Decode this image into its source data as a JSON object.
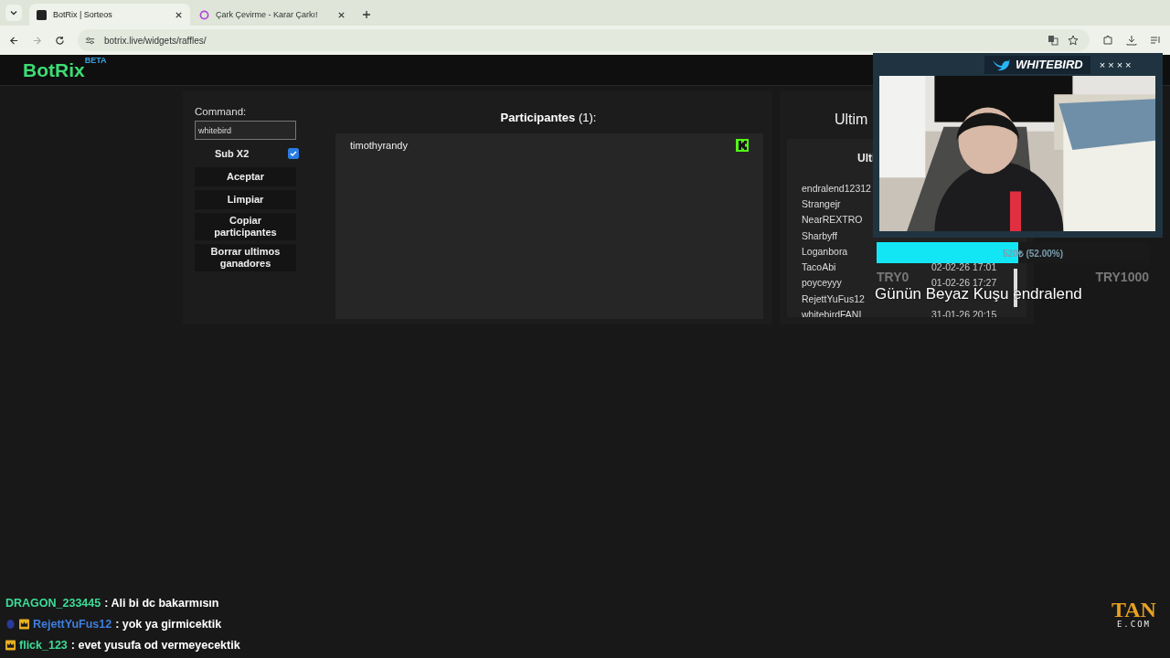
{
  "browser": {
    "tabs": [
      {
        "title": "BotRix | Sorteos",
        "selected": true
      },
      {
        "title": "Çark Çevirme - Karar Çarkı!",
        "selected": false
      }
    ],
    "url": "botrix.live/widgets/raffles/"
  },
  "header": {
    "logo": "BotRix",
    "badge": "BETA"
  },
  "controls": {
    "command_label": "Command:",
    "command_value": "whitebird",
    "sub_label": "Sub X2",
    "sub_checked": true,
    "buttons": [
      "Aceptar",
      "Limpiar",
      "Copiar participantes",
      "Borrar ultimos ganadores"
    ]
  },
  "participants": {
    "title": "Participantes",
    "count": "(1):",
    "items": [
      "timothyrandy"
    ]
  },
  "winners": {
    "title": "Ultim",
    "subtitle": "Ulti",
    "rows": [
      {
        "name": "endralend12312"
      },
      {
        "name": "Strangejr"
      },
      {
        "name": "NearREXTRO"
      },
      {
        "name": "Sharbyff"
      },
      {
        "name": "Loganbora"
      },
      {
        "name": "TacoAbi",
        "date": "02-02-26 17:01"
      },
      {
        "name": "poyceyyy",
        "date": "01-02-26 17:27"
      },
      {
        "name": "RejettYuFus12"
      },
      {
        "name": "whitebirdFANI",
        "date": "31-01-26 20:15"
      }
    ]
  },
  "webcam": {
    "name": "WHITEBIRD",
    "marks": "× × × ×",
    "kind": "picture"
  },
  "goal": {
    "level": 0.52,
    "reading": "520₺ (52.00%)",
    "min": "TRY0",
    "max": "TRY1000"
  },
  "caption": "Günün Beyaz Kuşu endralend",
  "chat": [
    {
      "user": "DRAGON_233445",
      "color": "#3ddc97",
      "text": ": Ali bi dc bakarmısın"
    },
    {
      "user": "RejettYuFus12",
      "color": "#3f7fe0",
      "badges": [
        {
          "kind": "drop"
        },
        {
          "kind": "crown"
        }
      ],
      "text": ": yok ya girmicektik"
    },
    {
      "user": "flick_123",
      "color": "#3ddc97",
      "badges": [
        {
          "kind": "crown"
        }
      ],
      "text": ": evet yusufa od vermeyecektik"
    }
  ],
  "watermark_logo": {
    "top": "TAN",
    "bottom": "E.COM"
  }
}
